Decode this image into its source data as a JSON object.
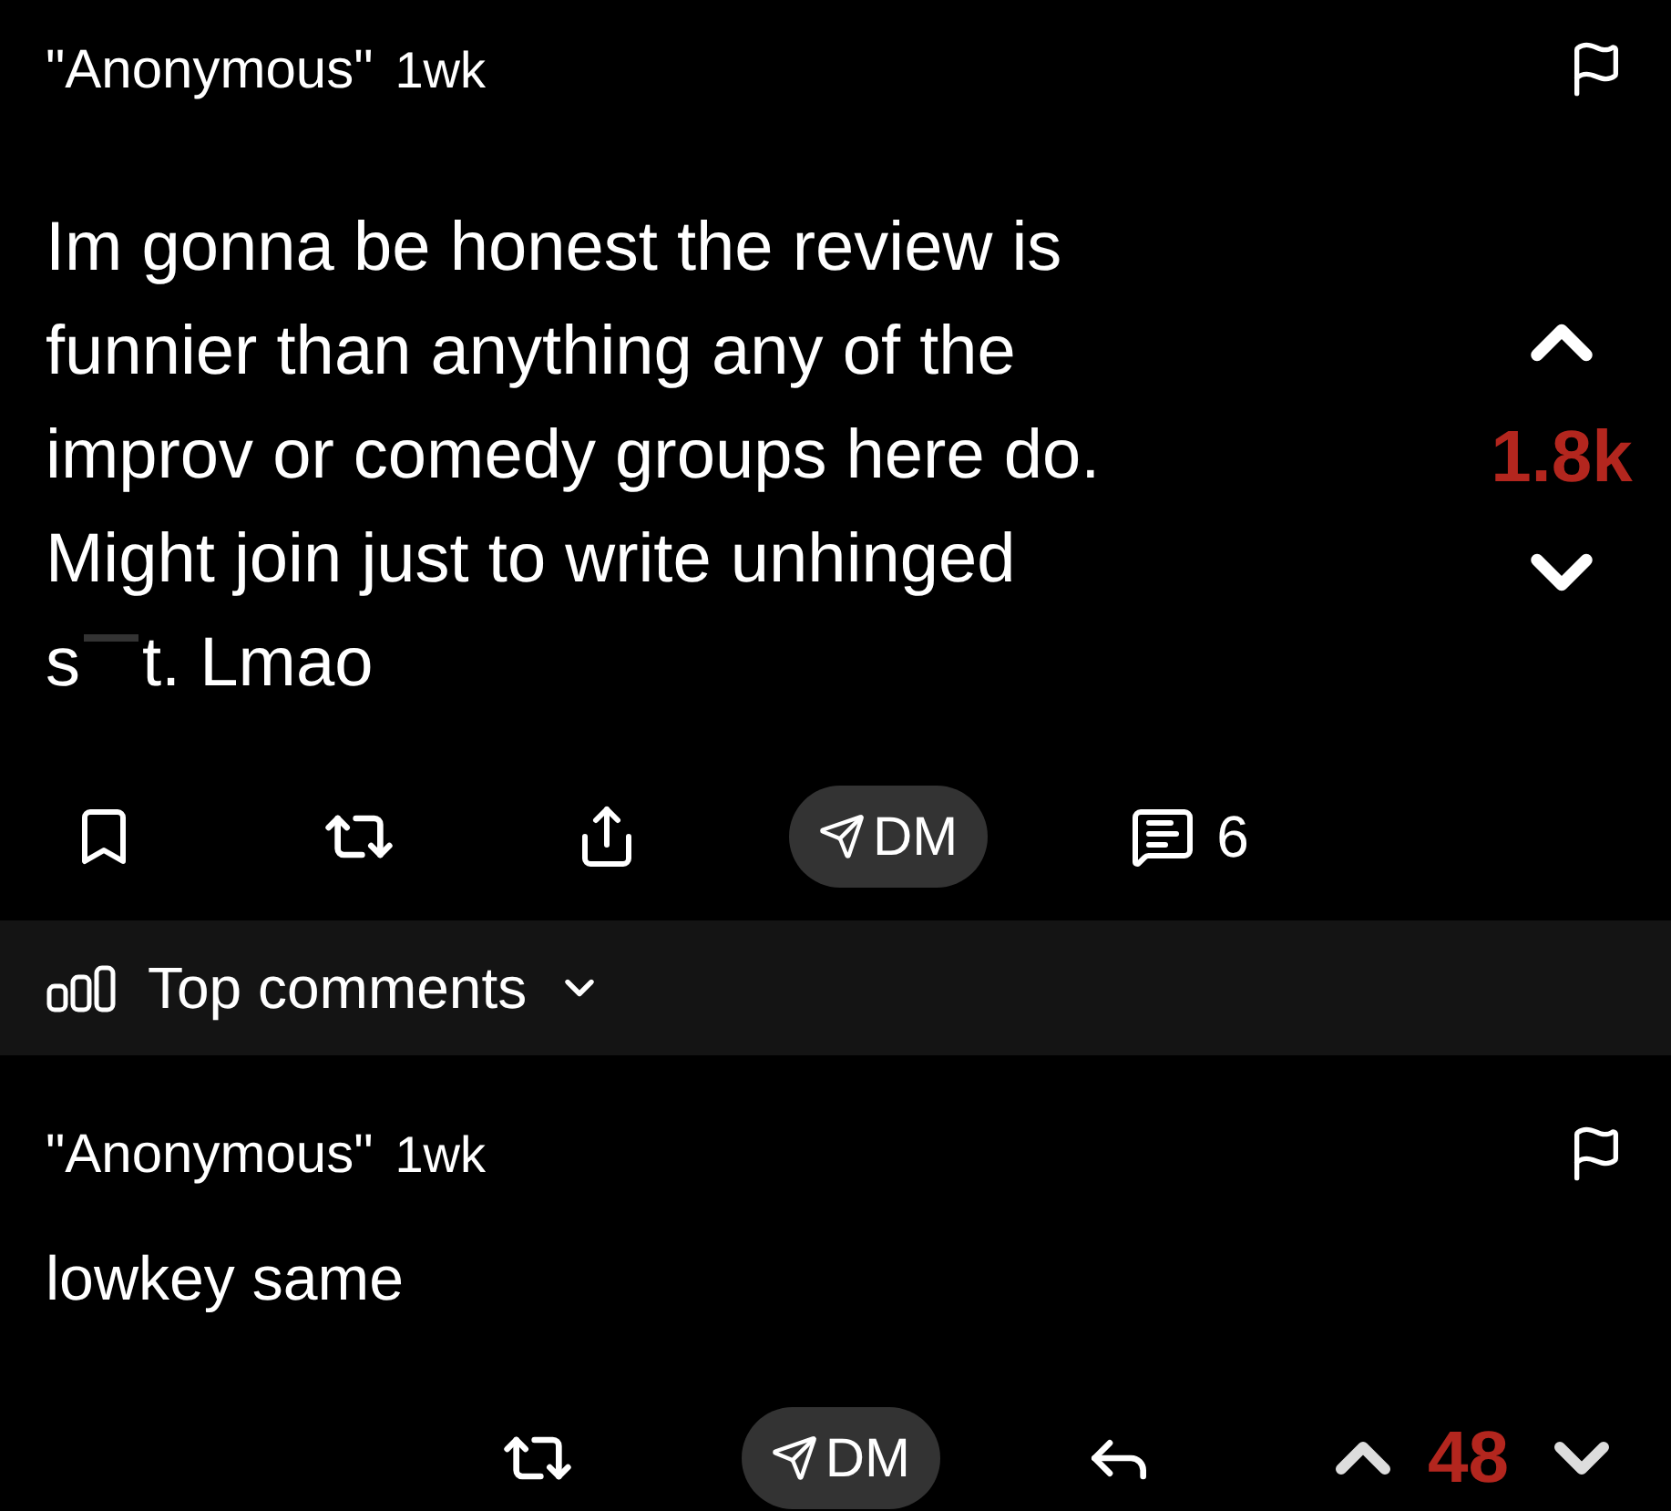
{
  "post": {
    "author": "\"Anonymous\"",
    "time": "1wk",
    "lines": [
      "Im gonna be honest the review is",
      "funnier than anything any of the",
      "improv or comedy groups here do.",
      "Might join just to write unhinged"
    ],
    "redacted_line": {
      "before": "s",
      "after": "t. Lmao"
    },
    "score": "1.8k",
    "dm": "DM",
    "comment_count": "6"
  },
  "sort": {
    "label": "Top comments"
  },
  "comments": [
    {
      "author": "\"Anonymous\"",
      "time": "1wk",
      "text": "lowkey same",
      "dm": "DM",
      "score": "48"
    }
  ]
}
